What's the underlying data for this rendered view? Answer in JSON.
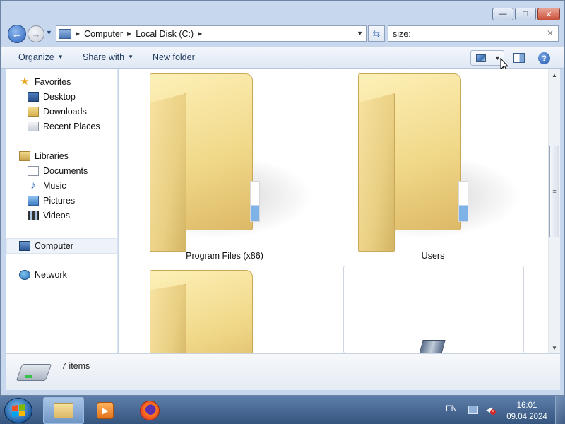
{
  "window": {
    "caption_buttons": {
      "minimize": "—",
      "maximize": "□",
      "close": "✕"
    }
  },
  "navigation": {
    "back_icon": "arrow-left-icon",
    "forward_icon": "arrow-right-icon",
    "breadcrumbs": [
      "Computer",
      "Local Disk (C:)"
    ],
    "search": {
      "value": "size:",
      "placeholder": ""
    }
  },
  "command_bar": {
    "organize": "Organize",
    "share_with": "Share with",
    "new_folder": "New folder"
  },
  "sidebar": {
    "favorites": {
      "label": "Favorites",
      "items": [
        "Desktop",
        "Downloads",
        "Recent Places"
      ]
    },
    "libraries": {
      "label": "Libraries",
      "items": [
        "Documents",
        "Music",
        "Pictures",
        "Videos"
      ]
    },
    "computer": "Computer",
    "network": "Network"
  },
  "content": {
    "items": [
      {
        "name": "Program Files (x86)",
        "type": "folder"
      },
      {
        "name": "Users",
        "type": "folder"
      },
      {
        "name": "",
        "type": "folder"
      },
      {
        "name": "",
        "type": "setup-file"
      }
    ]
  },
  "details": {
    "item_count": "7 items"
  },
  "taskbar": {
    "language": "EN",
    "time": "16:01",
    "date": "09.04.2024",
    "apps": [
      "windows-explorer",
      "media-player",
      "firefox"
    ]
  },
  "colors": {
    "accent": "#2a64bd",
    "folder": "#f1d98a",
    "taskbar": "#35557f"
  }
}
